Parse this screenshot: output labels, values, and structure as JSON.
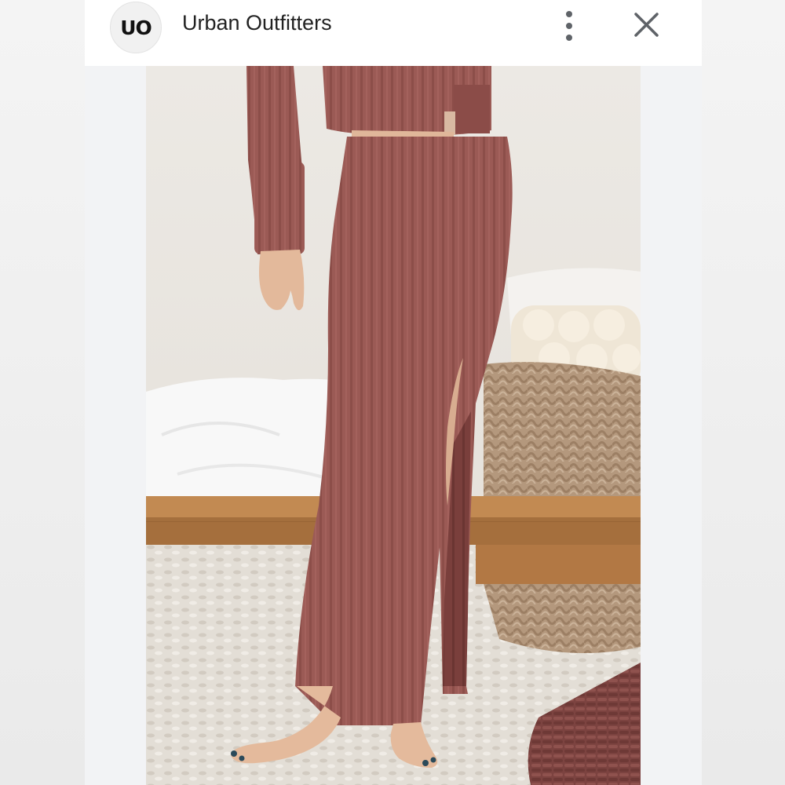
{
  "header": {
    "logo_text": "UO",
    "title": "Urban Outfitters",
    "more_icon": "more-vert-icon",
    "close_icon": "close-icon"
  },
  "photo": {
    "subject": "ribbed knit maxi skirt with side slit",
    "colors": {
      "skirt": "#9a5a55",
      "wall": "#ebe7e2",
      "bench": "#b9804c",
      "rug": "#e2ddd5"
    }
  }
}
